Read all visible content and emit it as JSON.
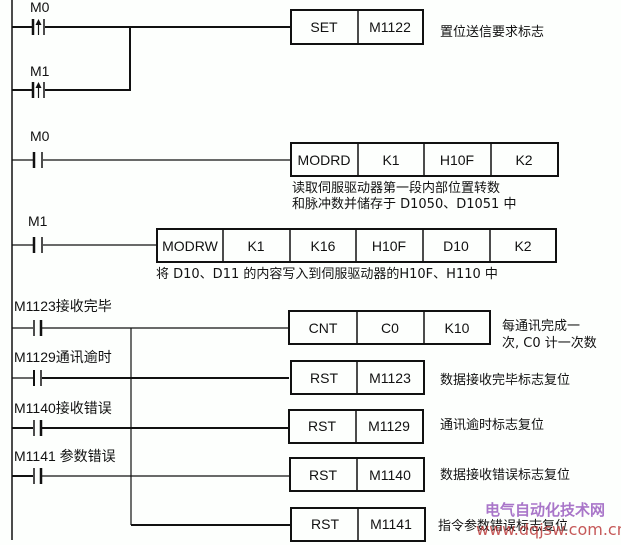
{
  "diagram": {
    "type": "PLC ladder diagram",
    "rungs": [
      {
        "id": "rung-set",
        "contacts": [
          {
            "label": "M0",
            "type": "rising-edge"
          },
          {
            "label": "M1",
            "type": "rising-edge"
          }
        ],
        "instruction": {
          "cells": [
            "SET",
            "M1122"
          ]
        },
        "comment": "置位送信要求标志"
      },
      {
        "id": "rung-modrd",
        "contacts": [
          {
            "label": "M0",
            "type": "normally-open"
          }
        ],
        "instruction": {
          "cells": [
            "MODRD",
            "K1",
            "H10F",
            "K2"
          ]
        },
        "comment_lines": [
          "读取伺服驱动器第一段内部位置转数",
          "和脉冲数并储存于 D1050、D1051 中"
        ]
      },
      {
        "id": "rung-modrw",
        "contacts": [
          {
            "label": "M1",
            "type": "normally-open"
          }
        ],
        "instruction": {
          "cells": [
            "MODRW",
            "K1",
            "K16",
            "H10F",
            "D10",
            "K2"
          ]
        },
        "comment": "将 D10、D11 的内容写入到伺服驱动器的H10F、H110 中"
      },
      {
        "id": "rung-status",
        "contacts": [
          {
            "label": "M1123接收完毕",
            "type": "normally-open"
          },
          {
            "label": "M1129通讯逾时",
            "type": "normally-open"
          },
          {
            "label": "M1140接收错误",
            "type": "normally-open"
          },
          {
            "label": "M1141 参数错误",
            "type": "normally-open"
          }
        ],
        "instructions": [
          {
            "cells": [
              "CNT",
              "C0",
              "K10"
            ],
            "comment_lines": [
              "每通讯完成一",
              "次, C0 计一次数"
            ]
          },
          {
            "cells": [
              "RST",
              "M1123"
            ],
            "comment": "数据接收完毕标志复位"
          },
          {
            "cells": [
              "RST",
              "M1129"
            ],
            "comment": "通讯逾时标志复位"
          },
          {
            "cells": [
              "RST",
              "M1140"
            ],
            "comment": "数据接收错误标志复位"
          },
          {
            "cells": [
              "RST",
              "M1141"
            ],
            "comment": "指令参数错误标志复位"
          }
        ]
      }
    ]
  },
  "watermark": {
    "title": "电气自动化技术网",
    "url": "www.dqjsw.com.cn",
    "title_color": "#9b5fc0",
    "url_color": "#b83030"
  }
}
